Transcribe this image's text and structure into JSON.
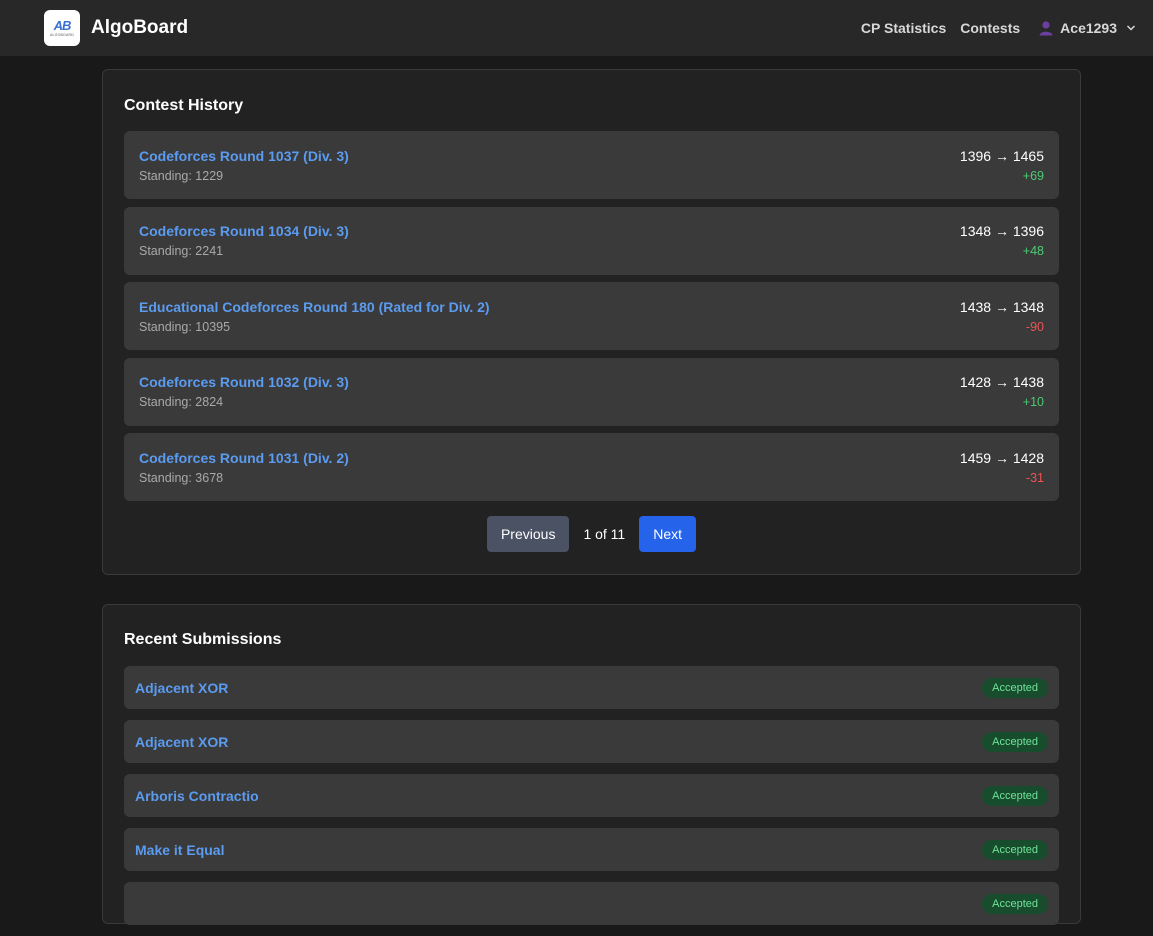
{
  "nav": {
    "brand": "AlgoBoard",
    "logo_mark": "AB",
    "logo_sub": "ALGOBOARD",
    "links": [
      "CP Statistics",
      "Contests"
    ],
    "username": "Ace1293"
  },
  "contest_history": {
    "title": "Contest History",
    "items": [
      {
        "name": "Codeforces Round 1037 (Div. 3)",
        "standing": "Standing: 1229",
        "rating": "1396 → 1465",
        "delta": "+69",
        "trend": "positive"
      },
      {
        "name": "Codeforces Round 1034 (Div. 3)",
        "standing": "Standing: 2241",
        "rating": "1348 → 1396",
        "delta": "+48",
        "trend": "positive"
      },
      {
        "name": "Educational Codeforces Round 180 (Rated for Div. 2)",
        "standing": "Standing: 10395",
        "rating": "1438 → 1348",
        "delta": "-90",
        "trend": "negative"
      },
      {
        "name": "Codeforces Round 1032 (Div. 3)",
        "standing": "Standing: 2824",
        "rating": "1428 → 1438",
        "delta": "+10",
        "trend": "positive"
      },
      {
        "name": "Codeforces Round 1031 (Div. 2)",
        "standing": "Standing: 3678",
        "rating": "1459 → 1428",
        "delta": "-31",
        "trend": "negative"
      }
    ],
    "pagination": {
      "prev_label": "Previous",
      "page_info": "1 of 11",
      "next_label": "Next"
    }
  },
  "recent_submissions": {
    "title": "Recent Submissions",
    "items": [
      {
        "name": "Adjacent XOR",
        "verdict": "Accepted"
      },
      {
        "name": "Adjacent XOR",
        "verdict": "Accepted"
      },
      {
        "name": "Arboris Contractio",
        "verdict": "Accepted"
      },
      {
        "name": "Make it Equal",
        "verdict": "Accepted"
      },
      {
        "name": "",
        "verdict": "Accepted"
      }
    ]
  },
  "colors": {
    "accent": "#2563eb",
    "link": "#5b9bf0",
    "positive": "#4ccb74",
    "negative": "#f05252",
    "accepted_bg": "#174d2c",
    "accepted_text": "#6fe29a"
  }
}
